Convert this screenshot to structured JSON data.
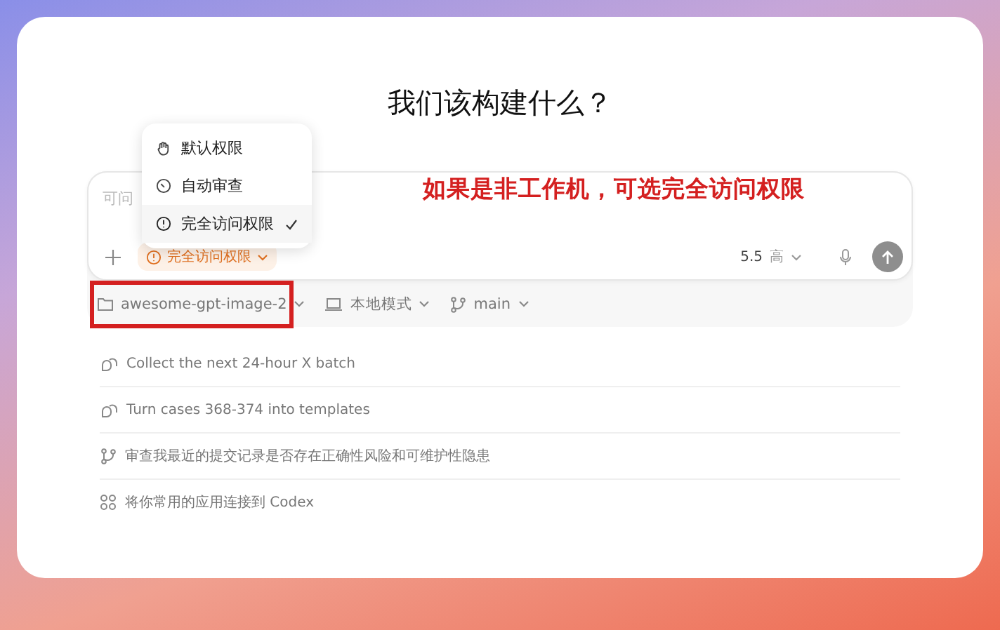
{
  "title": "我们该构建什么？",
  "composer": {
    "placeholder": "可问",
    "permission": "完全访问权限",
    "model": "5.5",
    "effort": "高"
  },
  "permission_menu": [
    {
      "label": "默认权限",
      "kind": "hand",
      "selected": false
    },
    {
      "label": "自动审查",
      "kind": "auto",
      "selected": false
    },
    {
      "label": "完全访问权限",
      "kind": "alert",
      "selected": true
    }
  ],
  "annotation": {
    "text": "如果是非工作机，可选完全访问权限"
  },
  "toolbar": {
    "repo": {
      "label": "awesome-gpt-image-2",
      "highlighted": true
    },
    "mode": "本地模式",
    "branch": "main"
  },
  "suggestions": [
    {
      "kind": "task",
      "text": "Collect the next 24-hour X batch"
    },
    {
      "kind": "task",
      "text": "Turn cases 368-374 into templates"
    },
    {
      "kind": "branch",
      "text": "审查我最近的提交记录是否存在正确性风险和可维护性隐患"
    },
    {
      "kind": "apps",
      "text": "将你常用的应用连接到 Codex"
    }
  ]
}
